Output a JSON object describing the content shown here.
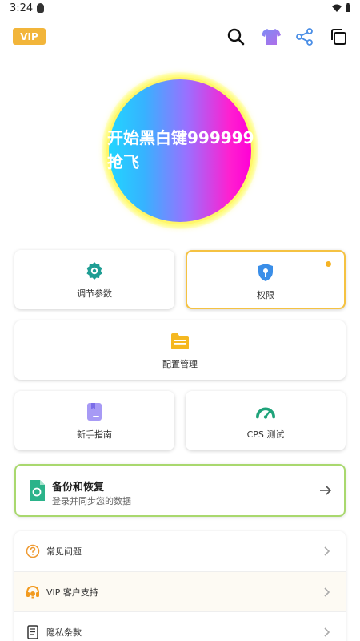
{
  "status": {
    "time": "3:24"
  },
  "header": {
    "vip_label": "VIP",
    "icons": [
      "search-icon",
      "tshirt-icon",
      "share-icon",
      "copy-icon"
    ]
  },
  "hero": {
    "label": "开始黑白键999999抢飞"
  },
  "grid": {
    "adjust_params": "调节参数",
    "permissions": "权限",
    "config_manage": "配置管理",
    "beginner_guide": "新手指南",
    "cps_test": "CPS 测试"
  },
  "backup": {
    "title": "备份和恢复",
    "subtitle": "登录并同步您的数据"
  },
  "list": {
    "items": [
      {
        "label": "常见问题",
        "icon": "question-circle-icon"
      },
      {
        "label": "VIP 客户支持",
        "icon": "headset-icon"
      },
      {
        "label": "隐私条款",
        "icon": "document-icon"
      }
    ]
  },
  "colors": {
    "accent_yellow": "#f2b53a",
    "teal": "#1fa396",
    "blue": "#3a8ee8",
    "green_border": "#a9d86e"
  }
}
